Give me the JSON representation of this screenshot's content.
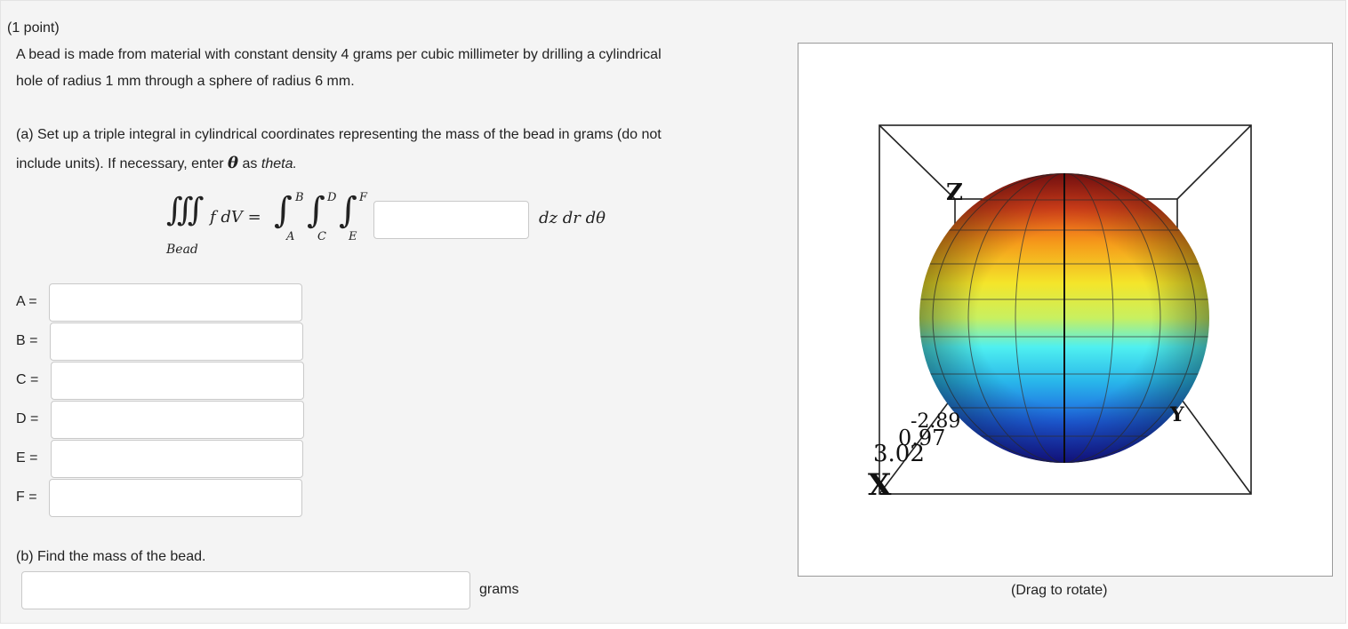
{
  "problem": {
    "points": "(1 point)",
    "intro_line1": "A bead is made from material with constant density 4 grams per cubic millimeter by drilling a cylindrical",
    "intro_line2": "hole of radius 1 mm through a sphere of radius 6 mm.",
    "part_a_line1": "(a) Set up a triple integral in cylindrical coordinates representing the mass of the bead in grams (do not",
    "part_a_line2_pre": "include units). If necessary, enter",
    "part_a_theta_symbol": "θ",
    "part_a_line2_mid": "as",
    "part_a_line2_em": "theta.",
    "part_b": "(b) Find the mass of the bead."
  },
  "integral": {
    "triple_sign": "∭",
    "integrand": "f dV =",
    "region": "Bead",
    "int_sign": "∫",
    "upper1": "B",
    "lower1": "A",
    "upper2": "D",
    "lower2": "C",
    "upper3": "F",
    "lower3": "E",
    "differentials": "dz dr dθ",
    "integrand_value": ""
  },
  "fields": [
    {
      "label": "A =",
      "value": ""
    },
    {
      "label": "B =",
      "value": ""
    },
    {
      "label": "C =",
      "value": ""
    },
    {
      "label": "D =",
      "value": ""
    },
    {
      "label": "E =",
      "value": ""
    },
    {
      "label": "F =",
      "value": ""
    }
  ],
  "mass": {
    "value": "",
    "unit": "grams"
  },
  "viewer": {
    "caption": "(Drag to rotate)",
    "axis_z": "Z",
    "axis_x": "X",
    "axis_y": "Y",
    "tick_labels": [
      "-2.89",
      "0.97",
      "3.02"
    ]
  }
}
